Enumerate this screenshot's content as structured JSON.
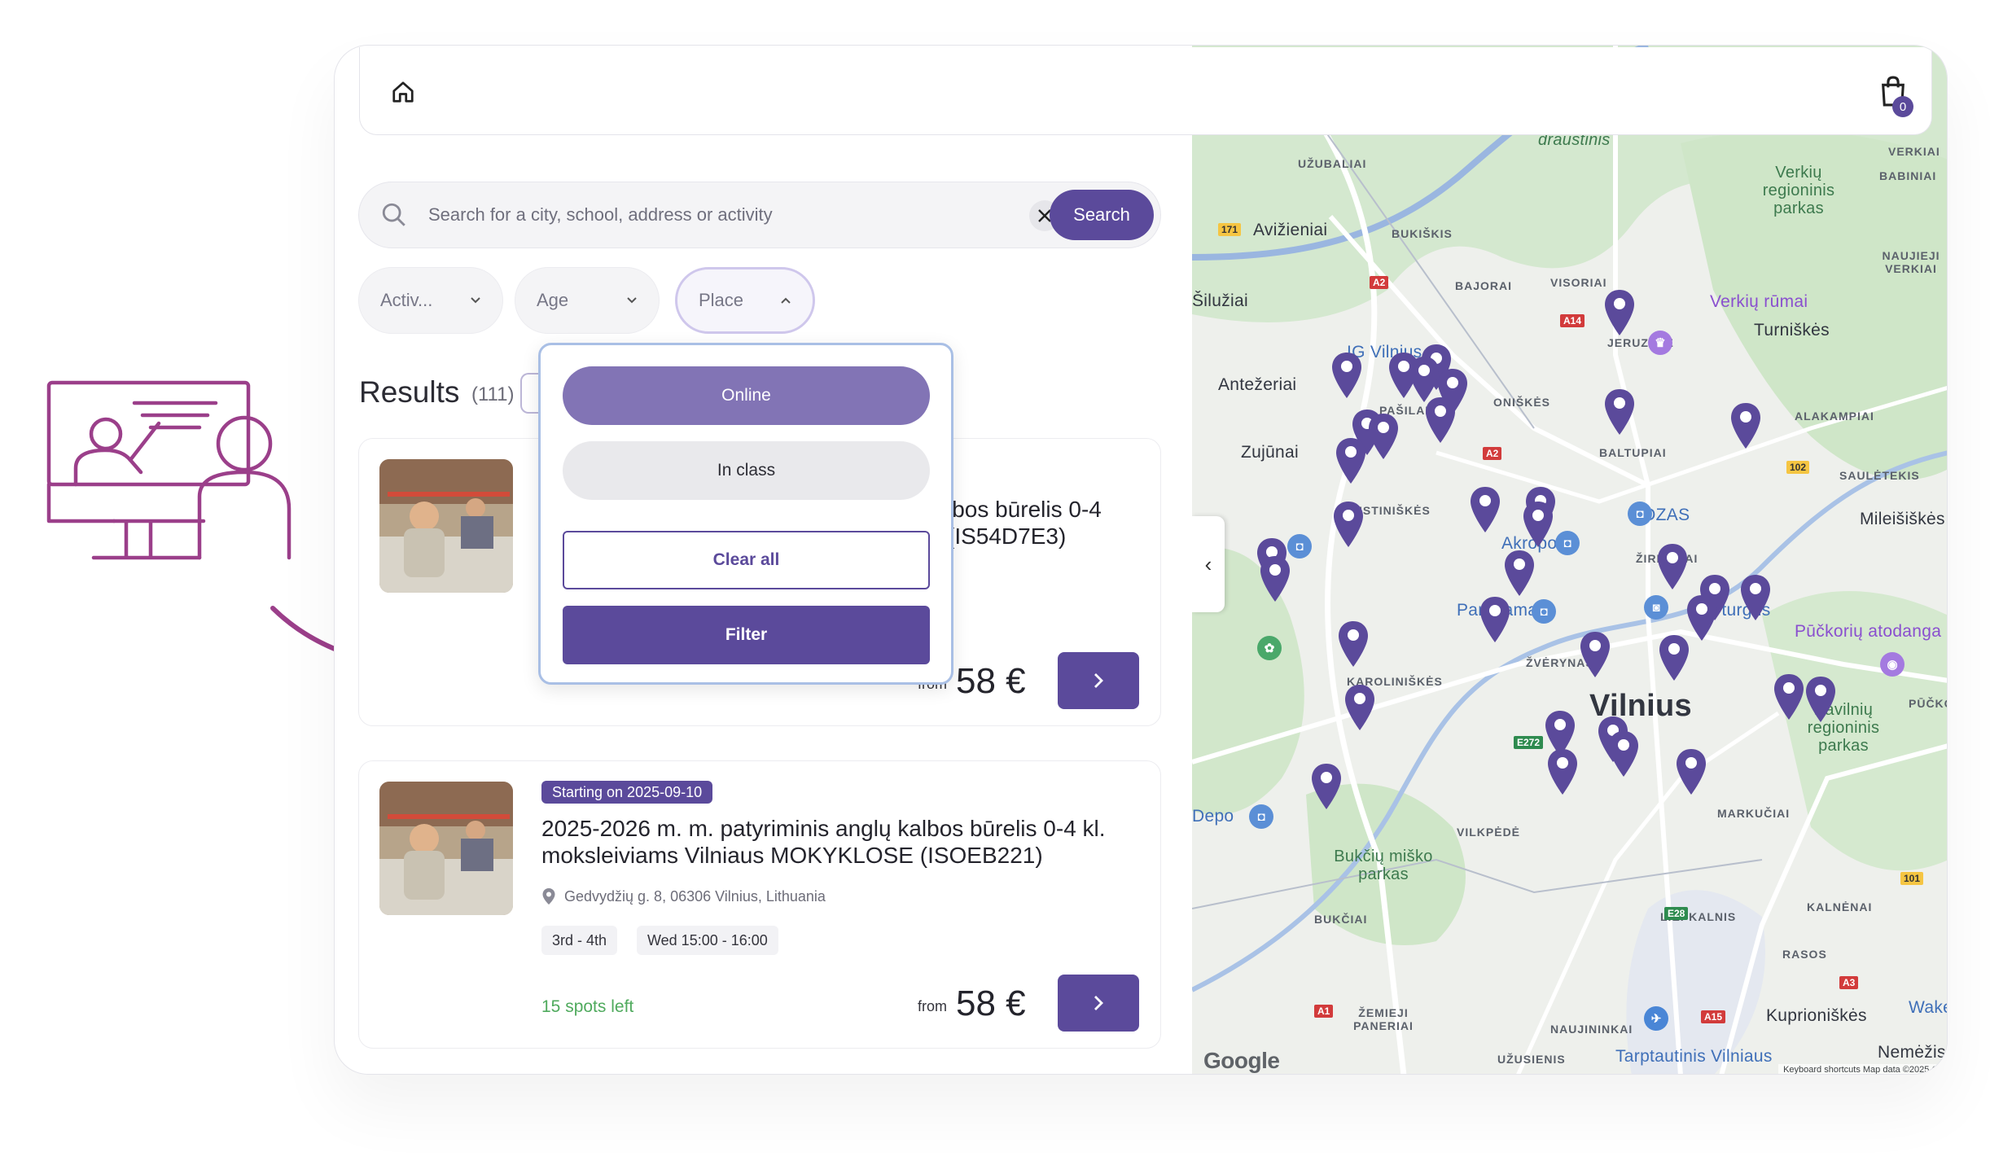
{
  "header": {
    "home_icon": "home-icon",
    "cart_icon": "shopping-bag-icon",
    "cart_count": "0"
  },
  "search": {
    "placeholder": "Search for a city, school, address or activity",
    "value": "",
    "button_label": "Search"
  },
  "filters": {
    "activity_label": "Activ...",
    "age_label": "Age",
    "place_label": "Place"
  },
  "place_dropdown": {
    "options": [
      "Online",
      "In class"
    ],
    "selected": "Online",
    "clear_label": "Clear all",
    "filter_label": "Filter"
  },
  "results": {
    "title": "Results",
    "count": "(111)"
  },
  "cards": [
    {
      "title_visible": "lbos būrelis 0-4\n(IS54D7E3)",
      "price_from": "from",
      "price": "58 €"
    },
    {
      "badge": "Starting on 2025-09-10",
      "title": "2025-2026 m. m. patyriminis anglų kalbos būrelis 0-4 kl. moksleiviams Vilniaus MOKYKLOSE (ISOEB221)",
      "address": "Gedvydžių g. 8, 06306 Vilnius, Lithuania",
      "tags": [
        "3rd - 4th",
        "Wed 15:00 - 16:00"
      ],
      "spots_left": "15 spots left",
      "price_from": "from",
      "price": "58 €"
    }
  ],
  "map": {
    "city": "Vilnius",
    "labels": [
      "UŽUBALIAI",
      "draustinis",
      "Verkių regioninis parkas",
      "Avižieniai",
      "BUKIŠKIS",
      "BAJORAI",
      "VISORIAI",
      "NAUJIEJI VERKIAI",
      "BABINIAI",
      "VERKIAI",
      "Verkių rūmai",
      "Turniškės",
      "Šilužiai",
      "JERUZALĖ",
      "IG Vilnius",
      "Antežeriai",
      "PAŠILAIČIAI",
      "ONIŠKĖS",
      "ALAKAMPIAI",
      "Zujūnai",
      "BALTUPIAI",
      "SAULĖTEKIS",
      "OZAS",
      "Mileišiškės",
      "JUSTINIŠKĖS",
      "Akropolis",
      "ŽIRMŪNAI",
      "Panorama",
      "rijų turgus",
      "Pūčkorių atodanga",
      "ŽVĖRYNAS",
      "KAROLINIŠKĖS",
      "PŪČKORI",
      "Pavilnių regioninis parkas",
      "Depo",
      "VILKPĖDĖ",
      "MARKUČIAI",
      "Bukčių miško parkas",
      "BUKČIAI",
      "LIEPKALNIS",
      "KALNĖNAI",
      "RASOS",
      "ŽEMIEJI PANERIAI",
      "NAUJININKAI",
      "Kuprioniškės",
      "UŽUSIENIS",
      "Tarptautinis Vilniaus",
      "Nemėžis",
      "Wake"
    ],
    "google": "Google",
    "credits": "Keyboard shortcuts   Map data ©2025 G"
  },
  "colors": {
    "brand": "#5b4a9b",
    "option_selected": "#8274b5",
    "spots_green": "#4faa5d",
    "pin": "#5b4a9b",
    "decoration": "#9b3f8a"
  }
}
